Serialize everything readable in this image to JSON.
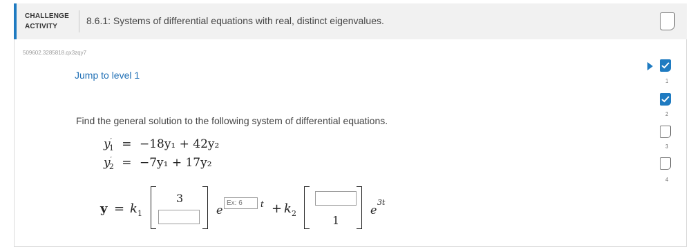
{
  "header": {
    "label_line1": "CHALLENGE",
    "label_line2": "ACTIVITY",
    "title": "8.6.1: Systems of differential equations with real, distinct eigenvalues."
  },
  "activity_id": "509602.3285818.qx3zqy7",
  "jump_link": "Jump to level 1",
  "prompt": "Find the general solution to the following system of differential equations.",
  "equations": {
    "eq1": {
      "lhs": "y",
      "lhs_sub": "1",
      "op": "=",
      "rhs": "−18y₁ + 42y₂"
    },
    "eq2": {
      "lhs": "y",
      "lhs_sub": "2",
      "op": "=",
      "rhs": "−7y₁ + 17y₂"
    }
  },
  "solution": {
    "y_label": "y",
    "equals": "=",
    "k1": "k",
    "k1_sub": "1",
    "vec1_top": "3",
    "vec1_bottom_value": "",
    "e1": "e",
    "exponent_input_placeholder": "Ex: 6",
    "t": "t",
    "plus": "+",
    "k2": "k",
    "k2_sub": "2",
    "vec2_top_value": "",
    "vec2_bottom": "1",
    "e2": "e",
    "e2_exponent": "3t"
  },
  "levels": [
    {
      "number": "1",
      "status": "complete"
    },
    {
      "number": "2",
      "status": "complete"
    },
    {
      "number": "3",
      "status": "incomplete"
    },
    {
      "number": "4",
      "status": "incomplete"
    }
  ],
  "colors": {
    "accent": "#1f7bc1",
    "header_bg": "#f1f1f1",
    "link": "#1f6fb5"
  }
}
